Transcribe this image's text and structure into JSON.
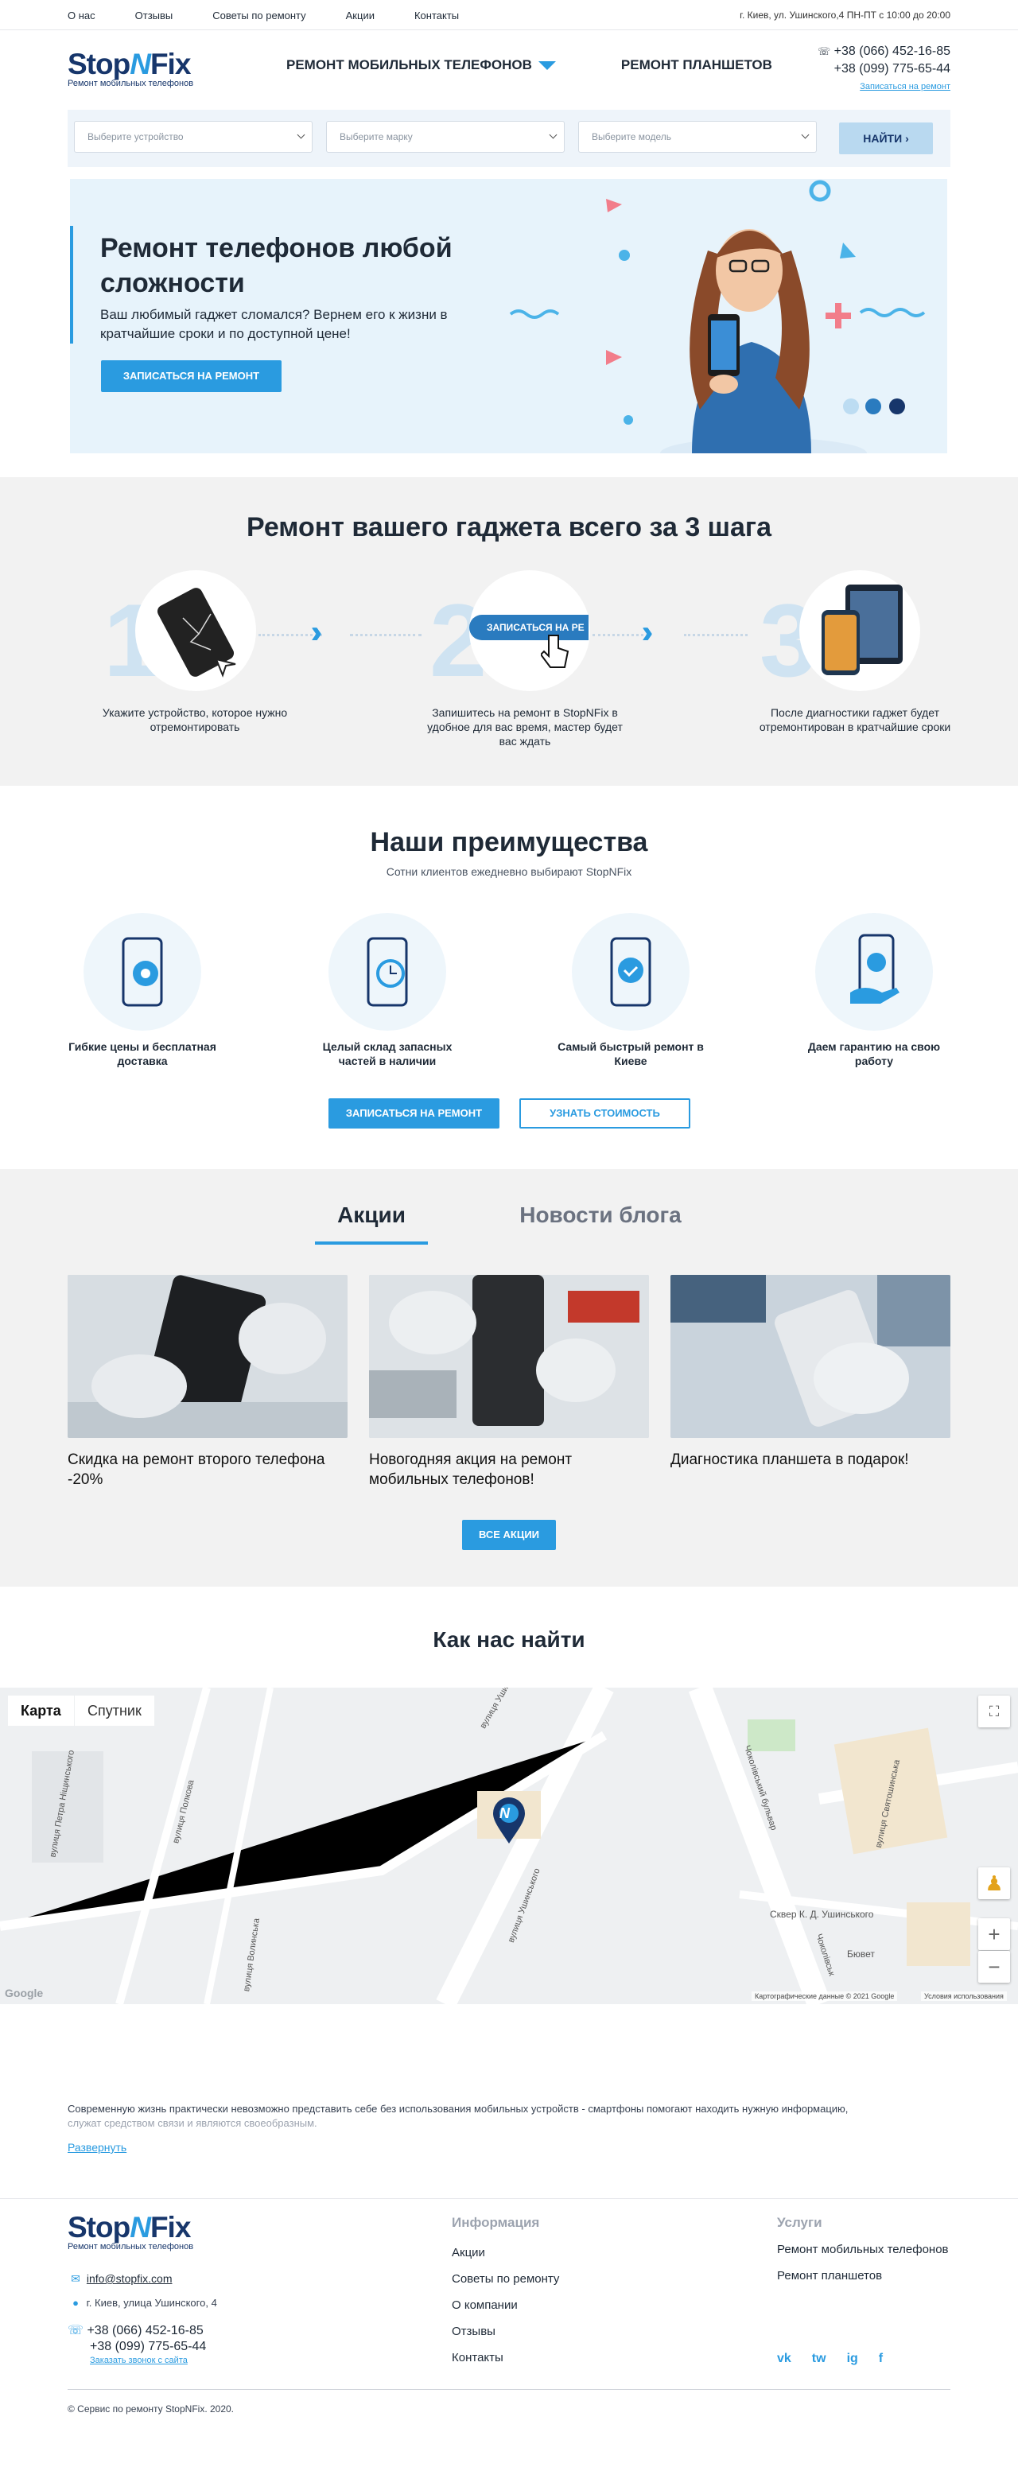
{
  "topbar": {
    "nav": [
      "О нас",
      "Отзывы",
      "Советы по ремонту",
      "Акции",
      "Контакты"
    ],
    "address": "г. Киев, ул. Ушинского,4 ПН-ПТ с 10:00 до 20:00"
  },
  "header": {
    "logo_left": "Stop",
    "logo_mid": "N",
    "logo_right": "Fix",
    "logo_sub": "Ремонт мобильных телефонов",
    "nav": [
      "Ремонт мобильных телефонов",
      "Ремонт планшетов"
    ],
    "phone1": "+38 (066) 452-16-85",
    "phone2": "+38 (099) 775-65-44",
    "callback": "Записаться на ремонт"
  },
  "search": {
    "device": "Выберите устройство",
    "brand": "Выберите марку",
    "model": "Выберите модель",
    "button": "НАЙТИ"
  },
  "hero": {
    "title": "Ремонт телефонов любой сложности",
    "text": "Ваш любимый гаджет сломался? Вернем его к жизни в кратчайшие сроки и по доступной цене!",
    "button": "Записаться на ремонт"
  },
  "steps": {
    "title": "Ремонт вашего гаджета всего за 3 шага",
    "items": [
      {
        "num": "1",
        "text": "Укажите устройство, которое нужно отремонтировать"
      },
      {
        "num": "2",
        "text": "Запишитесь на ремонт в StopNFix в удобное для вас время, мастер будет вас ждать",
        "badge": "ЗАПИСАТЬСЯ НА РЕ"
      },
      {
        "num": "3",
        "text": "После диагностики гаджет будет отремонтирован в кратчайшие сроки"
      }
    ]
  },
  "advantages": {
    "title": "Наши преимущества",
    "subtitle": "Сотни клиентов ежедневно выбирают StopNFix",
    "items": [
      "Гибкие цены и бесплатная доставка",
      "Целый склад запасных частей в наличии",
      "Самый быстрый ремонт в Киеве",
      "Даем гарантию на свою работу"
    ],
    "btn_primary": "Записаться на ремонт",
    "btn_secondary": "Узнать стоимость"
  },
  "promos": {
    "tabs": [
      "Акции",
      "Новости блога"
    ],
    "cards": [
      "Скидка на ремонт второго телефона -20%",
      "Новогодняя акция на ремонт мобильных телефонов!",
      "Диагностика планшета в подарок!"
    ],
    "all_button": "Все акции"
  },
  "map": {
    "title": "Как нас найти",
    "tab_map": "Карта",
    "tab_sat": "Спутник",
    "attribution": "Картографические данные © 2021 Google",
    "terms": "Условия использования",
    "logo": "Google",
    "streets": [
      "вулиця Ушинського",
      "вулиця Ушинського",
      "Чоколівський бульвар",
      "Чоколівськ",
      "Сквер К. Д. Ушинського",
      "Бювет",
      "вулиця Полкова",
      "вулиця Волинська",
      "вулиця Петра Ніщинського",
      "вулиця Святошинська"
    ]
  },
  "seo": {
    "text": "Современную жизнь практически невозможно представить себе без использования мобильных устройств - смартфоны помогают находить нужную информацию,",
    "text_faded": "служат средством связи и являются своеобразным.",
    "more": "Развернуть"
  },
  "footer": {
    "email": "info@stopfix.com",
    "address": "г. Киев, улица Ушинского, 4",
    "phone1": "+38 (066) 452-16-85",
    "phone2": "+38 (099) 775-65-44",
    "callback": "Заказать звонок с сайта",
    "info_title": "Информация",
    "info_links": [
      "Акции",
      "Советы по ремонту",
      "О компании",
      "Отзывы",
      "Контакты"
    ],
    "services_title": "Услуги",
    "services_links": [
      "Ремонт мобильных телефонов",
      "Ремонт планшетов"
    ],
    "social": [
      "vk",
      "tw",
      "ig",
      "f"
    ],
    "copyright": "© Сервис по ремонту StopNFix. 2020."
  },
  "colors": {
    "accent": "#2a9be0",
    "brand": "#17366b"
  }
}
